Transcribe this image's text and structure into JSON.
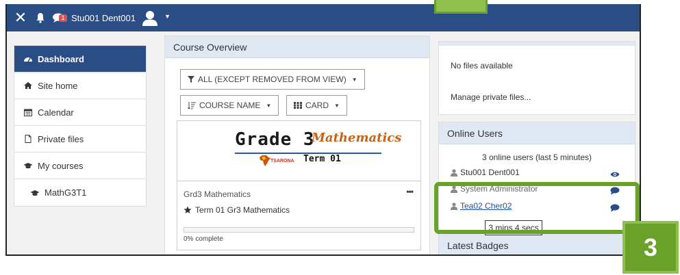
{
  "navbar": {
    "user_name": "Stu001 Dent001",
    "message_count": "1",
    "close_icon": "close-icon",
    "bell_icon": "bell-icon",
    "chat_icon": "chat-icon",
    "color": "#2b4d86"
  },
  "sidebar": {
    "items": [
      {
        "label": "Dashboard",
        "icon": "dashboard-icon",
        "active": true
      },
      {
        "label": "Site home",
        "icon": "home-icon"
      },
      {
        "label": "Calendar",
        "icon": "calendar-icon"
      },
      {
        "label": "Private files",
        "icon": "file-icon"
      },
      {
        "label": "My courses",
        "icon": "graduation-cap-icon"
      },
      {
        "label": "MathG3T1",
        "icon": "graduation-cap-icon"
      }
    ]
  },
  "course_overview": {
    "title": "Course Overview",
    "filter_label": "ALL (EXCEPT REMOVED FROM VIEW)",
    "sort_label": "COURSE NAME",
    "view_label": "CARD",
    "card": {
      "image_title": "Grade 3",
      "image_subject": "Mathematics",
      "image_brand": "TSARONA",
      "image_term": "Term 01",
      "short_name": "Grd3 Mathematics",
      "more_label": "•••",
      "full_name": "Term 01 Gr3 Mathematics",
      "progress_percent": 0,
      "progress_label": "0% complete"
    }
  },
  "private_files": {
    "empty_text": "No files available",
    "manage_link": "Manage private files..."
  },
  "online_users": {
    "title": "Online Users",
    "count_text": "3 online users (last 5 minutes)",
    "users": [
      {
        "name": "Stu001 Dent001",
        "action_icon": "eye-icon"
      },
      {
        "name": "System Administrator",
        "action_icon": "message-icon"
      },
      {
        "name": "Tea02 Cher02",
        "action_icon": "message-icon"
      }
    ],
    "tooltip": "3 mins 4 secs"
  },
  "latest_badges": {
    "title": "Latest Badges"
  },
  "annotation": {
    "step": "3",
    "color": "#6aa12b"
  }
}
